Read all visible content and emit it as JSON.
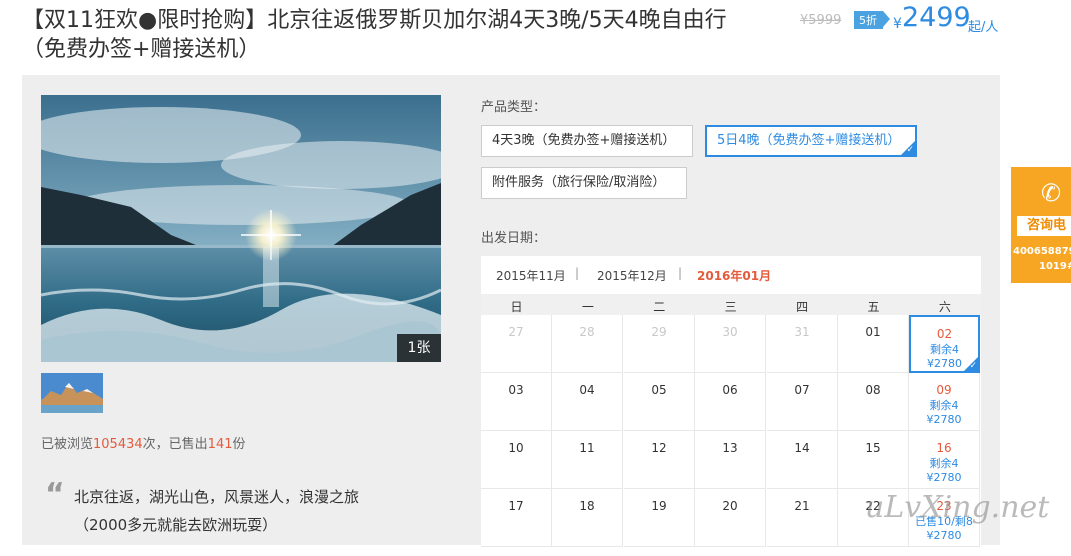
{
  "header": {
    "title": "【双11狂欢●限时抢购】北京往返俄罗斯贝加尔湖4天3晚/5天4晚自由行（免费办签+赠接送机）",
    "old_price": "¥5999",
    "discount": "5折",
    "currency": "¥",
    "price": "2499",
    "unit": "起/人"
  },
  "gallery": {
    "photo_count": "1张"
  },
  "stats": {
    "prefix": "已被浏览",
    "views": "105434",
    "mid": "次，已售出",
    "sold": "141",
    "suffix": "份"
  },
  "description": {
    "line1": "北京往返，湖光山色，风景迷人，浪漫之旅",
    "line2": "（2000多元就能去欧洲玩耍）"
  },
  "product": {
    "type_label": "产品类型：",
    "options": [
      {
        "label": "4天3晚（免费办签+赠接送机）",
        "selected": false
      },
      {
        "label": "5日4晚（免费办签+赠接送机）",
        "selected": true
      },
      {
        "label": "附件服务（旅行保险/取消险）",
        "selected": false
      }
    ],
    "date_label": "出发日期："
  },
  "calendar": {
    "months": [
      {
        "label": "2015年11月",
        "active": false
      },
      {
        "label": "2015年12月",
        "active": false
      },
      {
        "label": "2016年01月",
        "active": true
      }
    ],
    "separator": "|",
    "weekdays": [
      "日",
      "一",
      "二",
      "三",
      "四",
      "五",
      "六"
    ],
    "rows": [
      [
        {
          "d": "27",
          "past": true
        },
        {
          "d": "28",
          "past": true
        },
        {
          "d": "29",
          "past": true
        },
        {
          "d": "30",
          "past": true
        },
        {
          "d": "31",
          "past": true
        },
        {
          "d": "01"
        },
        {
          "d": "02",
          "avail": true,
          "line1": "剩余4",
          "line2": "¥2780",
          "selected": true
        }
      ],
      [
        {
          "d": "03"
        },
        {
          "d": "04"
        },
        {
          "d": "05"
        },
        {
          "d": "06"
        },
        {
          "d": "07"
        },
        {
          "d": "08"
        },
        {
          "d": "09",
          "avail": true,
          "line1": "剩余4",
          "line2": "¥2780"
        }
      ],
      [
        {
          "d": "10"
        },
        {
          "d": "11"
        },
        {
          "d": "12"
        },
        {
          "d": "13"
        },
        {
          "d": "14"
        },
        {
          "d": "15"
        },
        {
          "d": "16",
          "avail": true,
          "line1": "剩余4",
          "line2": "¥2780"
        }
      ],
      [
        {
          "d": "17"
        },
        {
          "d": "18"
        },
        {
          "d": "19"
        },
        {
          "d": "20"
        },
        {
          "d": "21"
        },
        {
          "d": "22"
        },
        {
          "d": "23",
          "avail": true,
          "line1": "已售10/剩8",
          "line2": "¥2780"
        }
      ]
    ]
  },
  "consult": {
    "label": "咨询电",
    "phone1": "400658879",
    "phone2": "1019#",
    "icon": "phone-icon"
  },
  "watermark": "uLvXing.net",
  "colors": {
    "accent": "#2d8be2",
    "highlight": "#e65a3c",
    "consult": "#f6a623"
  }
}
